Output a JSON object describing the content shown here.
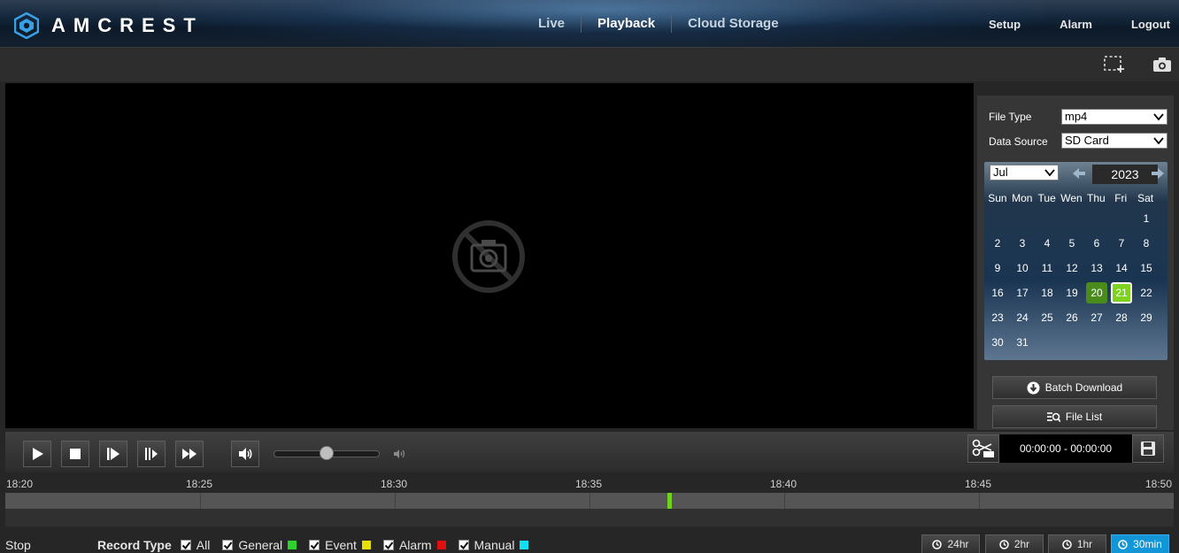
{
  "header": {
    "brand": "AMCREST",
    "nav": [
      "Live",
      "Playback",
      "Cloud Storage"
    ],
    "active_nav": "Playback",
    "right_nav": [
      "Setup",
      "Alarm",
      "Logout"
    ]
  },
  "toolbar": {
    "icons": [
      "region-select-icon",
      "snapshot-icon"
    ]
  },
  "video": {
    "placeholder_icon": "no-video-camera-icon"
  },
  "panel": {
    "file_type_label": "File Type",
    "file_type_value": "mp4",
    "data_source_label": "Data Source",
    "data_source_value": "SD Card",
    "calendar": {
      "month": "Jul",
      "year": "2023",
      "weekdays": [
        "Sun",
        "Mon",
        "Tue",
        "Wen",
        "Thu",
        "Fri",
        "Sat"
      ],
      "first_weekday_index": 6,
      "days_in_month": 31,
      "recorded_days": [
        20
      ],
      "selected_day": 21,
      "recorded_color": "#4a8c1c",
      "selected_color": "#7ed321"
    },
    "batch_download": "Batch Download",
    "file_list": "File List"
  },
  "controls": {
    "buttons": [
      "play-icon",
      "stop-icon",
      "step-play-icon",
      "slow-play-icon",
      "fast-forward-icon",
      "volume-icon"
    ],
    "volume_level": 0.5,
    "clip_time": "00:00:00 - 00:00:00"
  },
  "timeline": {
    "labels": [
      "18:20",
      "18:25",
      "18:30",
      "18:35",
      "18:40",
      "18:45",
      "18:50"
    ],
    "record_marker_time": "18:37",
    "marker_color": "#6fd21e"
  },
  "bottom": {
    "status": "Stop",
    "record_type_label": "Record Type",
    "record_types": [
      {
        "label": "All",
        "color": ""
      },
      {
        "label": "General",
        "color": "#2fd12f"
      },
      {
        "label": "Event",
        "color": "#e8e000"
      },
      {
        "label": "Alarm",
        "color": "#e01010"
      },
      {
        "label": "Manual",
        "color": "#10e0f0"
      }
    ],
    "zoom_options": [
      "24hr",
      "2hr",
      "1hr",
      "30min"
    ],
    "active_zoom": "30min"
  }
}
